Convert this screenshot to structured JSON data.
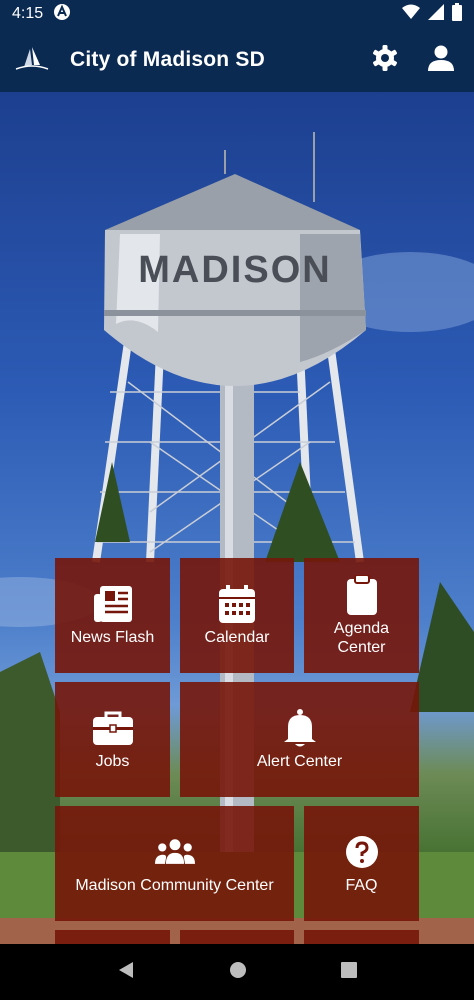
{
  "status_bar": {
    "time": "4:15"
  },
  "app_bar": {
    "title": "City of Madison SD"
  },
  "tower": {
    "text": "MADISON"
  },
  "tiles": [
    {
      "label": "News Flash",
      "icon": "newspaper-icon"
    },
    {
      "label": "Calendar",
      "icon": "calendar-icon"
    },
    {
      "label": "Agenda Center",
      "icon": "clipboard-icon"
    },
    {
      "label": "Jobs",
      "icon": "briefcase-icon"
    },
    {
      "label": "Alert Center",
      "icon": "bell-icon"
    },
    {
      "label": "Madison Community Center",
      "icon": "people-icon"
    },
    {
      "label": "FAQ",
      "icon": "question-icon"
    }
  ],
  "colors": {
    "app_bar": "#0b2a52",
    "tile": "#76160a"
  }
}
